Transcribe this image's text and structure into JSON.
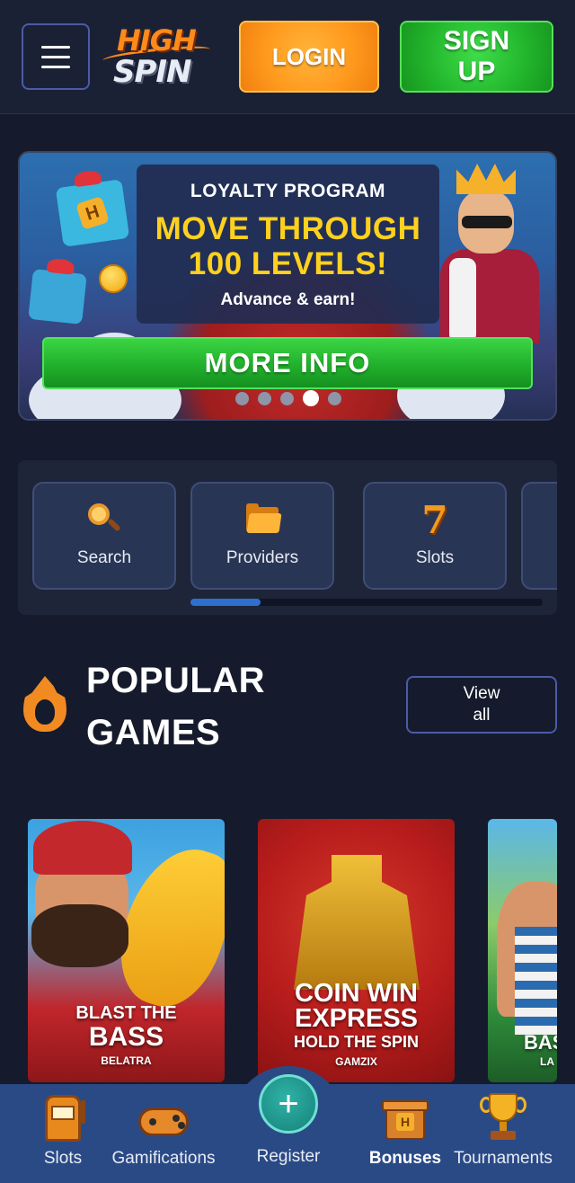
{
  "header": {
    "menu_label": "",
    "logo": {
      "line1": "HIGH",
      "line2": "SPIN"
    },
    "login_label": "LOGIN",
    "signup_label": "SIGN UP"
  },
  "banner": {
    "kicker": "LOYALTY PROGRAM",
    "headline": "MOVE THROUGH 100 LEVELS!",
    "subtext": "Advance & earn!",
    "cta_label": "MORE INFO",
    "slides_count": 5,
    "active_slide": 4
  },
  "quick_links": {
    "items": [
      {
        "label": "Search",
        "icon": "search-icon"
      },
      {
        "label": "Providers",
        "icon": "folder-icon"
      },
      {
        "label": "Slots",
        "icon": "seven-icon"
      }
    ],
    "scroll_position": 0.2
  },
  "popular": {
    "title": "POPULAR GAMES",
    "view_all_label": "View all",
    "icon": "fire-icon"
  },
  "games": [
    {
      "title_line1": "BLAST THE",
      "title_line2": "BASS",
      "provider": "BELATRA"
    },
    {
      "title_line1": "COIN WIN",
      "title_line2": "EXPRESS",
      "title_line3": "HOLD THE SPIN",
      "provider": "GAMZIX"
    },
    {
      "title_line1": "BAS",
      "provider": "LA"
    }
  ],
  "bottom_nav": {
    "items": [
      {
        "label": "Slots",
        "icon": "slot-machine-icon"
      },
      {
        "label": "Gamifications",
        "icon": "gamepad-icon"
      },
      {
        "label": "Register",
        "icon": "plus-icon"
      },
      {
        "label": "Bonuses",
        "icon": "gift-box-icon"
      },
      {
        "label": "Tournaments",
        "icon": "trophy-icon"
      }
    ],
    "plus_glyph": "+"
  },
  "colors": {
    "background": "#151b2c",
    "login": "#ff9a1e",
    "signup": "#22b52c",
    "headline_yellow": "#ffd11e",
    "nav_bar": "#2a4a86",
    "outline": "#4c5aa8"
  }
}
